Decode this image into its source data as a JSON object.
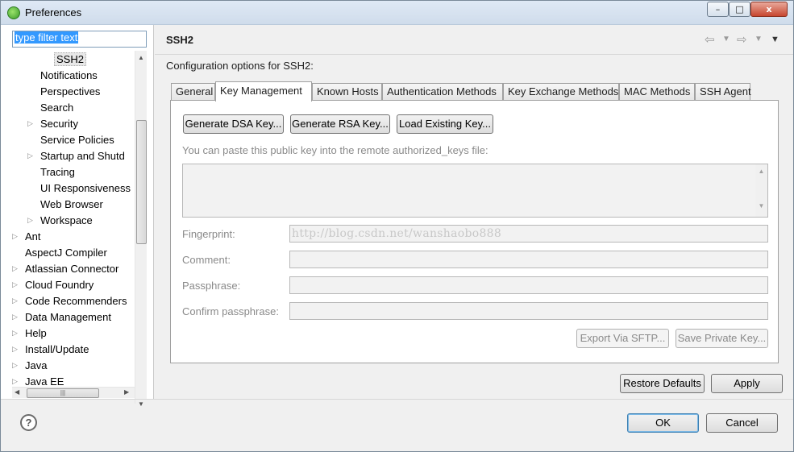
{
  "window": {
    "title": "Preferences",
    "controls": {
      "minimize": "–",
      "maximize": "□",
      "close": "x"
    }
  },
  "sidebar": {
    "filter_text": "type filter text",
    "tree": [
      {
        "label": "SSH2",
        "level": 3,
        "expandable": false,
        "selected": true
      },
      {
        "label": "Notifications",
        "level": 2,
        "expandable": false
      },
      {
        "label": "Perspectives",
        "level": 2,
        "expandable": false
      },
      {
        "label": "Search",
        "level": 2,
        "expandable": false
      },
      {
        "label": "Security",
        "level": 2,
        "expandable": true
      },
      {
        "label": "Service Policies",
        "level": 2,
        "expandable": false
      },
      {
        "label": "Startup and Shutd",
        "level": 2,
        "expandable": true
      },
      {
        "label": "Tracing",
        "level": 2,
        "expandable": false
      },
      {
        "label": "UI Responsiveness",
        "level": 2,
        "expandable": false
      },
      {
        "label": "Web Browser",
        "level": 2,
        "expandable": false
      },
      {
        "label": "Workspace",
        "level": 2,
        "expandable": true
      },
      {
        "label": "Ant",
        "level": 1,
        "expandable": true
      },
      {
        "label": "AspectJ Compiler",
        "level": 1,
        "expandable": false
      },
      {
        "label": "Atlassian Connector",
        "level": 1,
        "expandable": true
      },
      {
        "label": "Cloud Foundry",
        "level": 1,
        "expandable": true
      },
      {
        "label": "Code Recommenders",
        "level": 1,
        "expandable": true
      },
      {
        "label": "Data Management",
        "level": 1,
        "expandable": true
      },
      {
        "label": "Help",
        "level": 1,
        "expandable": true
      },
      {
        "label": "Install/Update",
        "level": 1,
        "expandable": true
      },
      {
        "label": "Java",
        "level": 1,
        "expandable": true
      },
      {
        "label": "Java EE",
        "level": 1,
        "expandable": true
      }
    ]
  },
  "page": {
    "title": "SSH2",
    "description": "Configuration options for SSH2:",
    "tabs": [
      {
        "label": "General",
        "active": false
      },
      {
        "label": "Key Management",
        "active": true
      },
      {
        "label": "Known Hosts",
        "active": false
      },
      {
        "label": "Authentication Methods",
        "active": false
      },
      {
        "label": "Key Exchange Methods",
        "active": false
      },
      {
        "label": "MAC Methods",
        "active": false
      },
      {
        "label": "SSH Agent",
        "active": false
      }
    ],
    "key_management": {
      "generate_dsa": "Generate DSA Key...",
      "generate_rsa": "Generate RSA Key...",
      "load_existing": "Load Existing Key...",
      "paste_hint": "You can paste this public key into the remote authorized_keys file:",
      "fingerprint_label": "Fingerprint:",
      "fingerprint_value": "http://blog.csdn.net/wanshaobo888",
      "comment_label": "Comment:",
      "passphrase_label": "Passphrase:",
      "confirm_label": "Confirm passphrase:",
      "export_sftp": "Export Via SFTP...",
      "save_private": "Save Private Key..."
    },
    "restore_defaults": "Restore Defaults",
    "apply": "Apply"
  },
  "footer": {
    "help": "?",
    "ok": "OK",
    "cancel": "Cancel"
  }
}
